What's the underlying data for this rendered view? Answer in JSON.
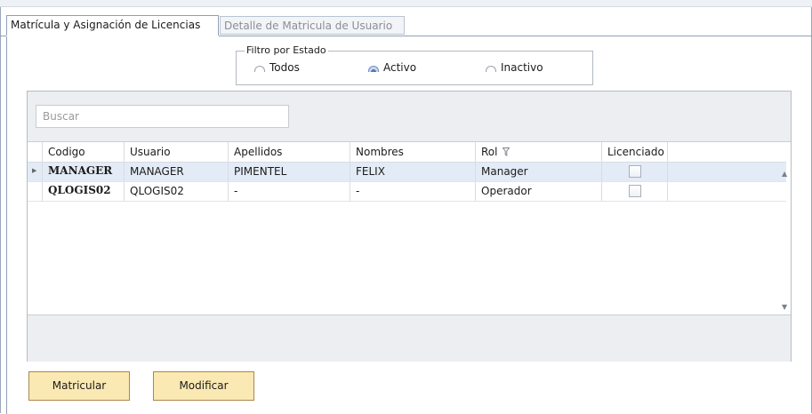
{
  "tabs": [
    {
      "label": "Matrícula y Asignación de Licencias",
      "active": true
    },
    {
      "label": "Detalle de Matricula de Usuario",
      "active": false
    }
  ],
  "filter": {
    "legend": "Filtro por Estado",
    "options": [
      {
        "label": "Todos",
        "checked": false
      },
      {
        "label": "Activo",
        "checked": true
      },
      {
        "label": "Inactivo",
        "checked": false
      }
    ]
  },
  "search": {
    "placeholder": "Buscar"
  },
  "grid": {
    "columns": [
      "Codigo",
      "Usuario",
      "Apellidos",
      "Nombres",
      "Rol",
      "Licenciado"
    ],
    "rows": [
      {
        "codigo": "MANAGER",
        "usuario": "MANAGER",
        "apellidos": "PIMENTEL",
        "nombres": "FELIX",
        "rol": "Manager",
        "licenciado": false,
        "selected": true
      },
      {
        "codigo": "QLOGIS02",
        "usuario": "QLOGIS02",
        "apellidos": "-",
        "nombres": "-",
        "rol": "Operador",
        "licenciado": false,
        "selected": false
      }
    ]
  },
  "buttons": {
    "matricular": "Matricular",
    "modificar": "Modificar"
  },
  "icons": {
    "filter": "filter-icon",
    "row_indicator": "row-pointer-icon"
  }
}
